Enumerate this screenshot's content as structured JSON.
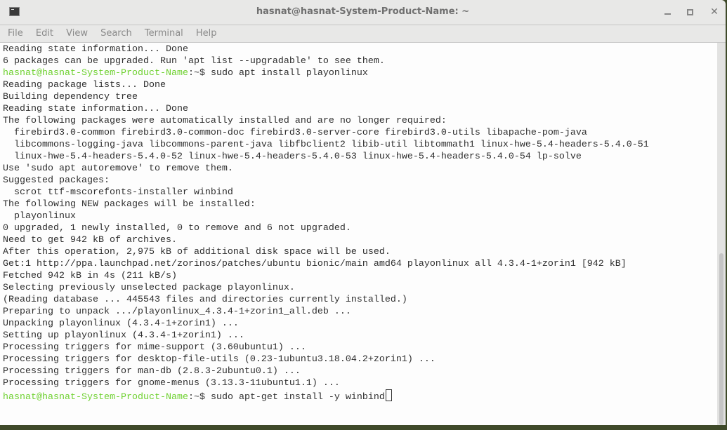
{
  "window": {
    "title": "hasnat@hasnat-System-Product-Name: ~"
  },
  "menu": [
    "File",
    "Edit",
    "View",
    "Search",
    "Terminal",
    "Help"
  ],
  "scrollbar": {
    "position_fraction": 0.55,
    "visible_fraction": 0.45
  },
  "prompt": {
    "user": "hasnat@hasnat-System-Product-Name",
    "path": ":~$"
  },
  "lines": [
    {
      "text": "Reading state information... Done"
    },
    {
      "text": "6 packages can be upgraded. Run 'apt list --upgradable' to see them."
    },
    {
      "prompt": true,
      "text": " sudo apt install playonlinux"
    },
    {
      "text": "Reading package lists... Done"
    },
    {
      "text": "Building dependency tree"
    },
    {
      "text": "Reading state information... Done"
    },
    {
      "text": "The following packages were automatically installed and are no longer required:"
    },
    {
      "text": "  firebird3.0-common firebird3.0-common-doc firebird3.0-server-core firebird3.0-utils libapache-pom-java"
    },
    {
      "text": "  libcommons-logging-java libcommons-parent-java libfbclient2 libib-util libtommath1 linux-hwe-5.4-headers-5.4.0-51"
    },
    {
      "text": "  linux-hwe-5.4-headers-5.4.0-52 linux-hwe-5.4-headers-5.4.0-53 linux-hwe-5.4-headers-5.4.0-54 lp-solve"
    },
    {
      "text": "Use 'sudo apt autoremove' to remove them."
    },
    {
      "text": "Suggested packages:"
    },
    {
      "text": "  scrot ttf-mscorefonts-installer winbind"
    },
    {
      "text": "The following NEW packages will be installed:"
    },
    {
      "text": "  playonlinux"
    },
    {
      "text": "0 upgraded, 1 newly installed, 0 to remove and 6 not upgraded."
    },
    {
      "text": "Need to get 942 kB of archives."
    },
    {
      "text": "After this operation, 2,975 kB of additional disk space will be used."
    },
    {
      "text": "Get:1 http://ppa.launchpad.net/zorinos/patches/ubuntu bionic/main amd64 playonlinux all 4.3.4-1+zorin1 [942 kB]"
    },
    {
      "text": "Fetched 942 kB in 4s (211 kB/s)"
    },
    {
      "text": "Selecting previously unselected package playonlinux."
    },
    {
      "text": "(Reading database ... 445543 files and directories currently installed.)"
    },
    {
      "text": "Preparing to unpack .../playonlinux_4.3.4-1+zorin1_all.deb ..."
    },
    {
      "text": "Unpacking playonlinux (4.3.4-1+zorin1) ..."
    },
    {
      "text": "Setting up playonlinux (4.3.4-1+zorin1) ..."
    },
    {
      "text": "Processing triggers for mime-support (3.60ubuntu1) ..."
    },
    {
      "text": "Processing triggers for desktop-file-utils (0.23-1ubuntu3.18.04.2+zorin1) ..."
    },
    {
      "text": "Processing triggers for man-db (2.8.3-2ubuntu0.1) ..."
    },
    {
      "text": "Processing triggers for gnome-menus (3.13.3-11ubuntu1.1) ..."
    },
    {
      "prompt": true,
      "text": " sudo apt-get install -y winbind",
      "cursor": true
    }
  ]
}
